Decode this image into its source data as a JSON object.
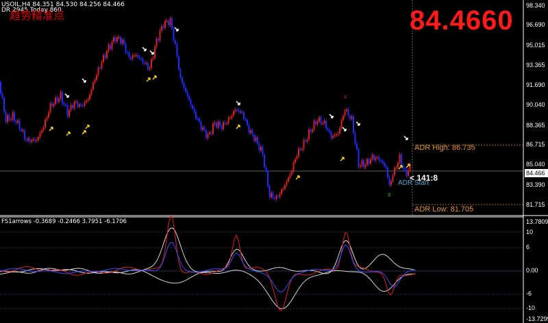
{
  "header": {
    "symbol_line": "USOIL,H4  84.351 84.530 84.256 84.466",
    "adr_line": "DR 2945  Today 860",
    "cn_title": "趋势精准点"
  },
  "overlay": {
    "big_price": "84.4660",
    "adr_high": "ADR High: 86.735",
    "adr_low": "ADR Low: 81.705",
    "ratio": "< 141:8",
    "adr_start": "ADR Start",
    "marker_top": "0",
    "marker_bottom": "0"
  },
  "price_axis": {
    "ticks": [
      "98.340",
      "96.690",
      "95.015",
      "93.365",
      "91.690",
      "90.040",
      "88.365",
      "86.715",
      "85.040",
      "83.390",
      "81.715"
    ],
    "current": "84.466"
  },
  "indicator": {
    "label": "FS1arrows -0.3689 -0.2466 3.7951 -6.1706",
    "ticks": [
      "13.7809",
      "10",
      "6",
      "0.00",
      "-6",
      "-10",
      "-13.7299"
    ]
  },
  "colors": {
    "bull": "#e01e1e",
    "bear": "#1f2bff",
    "adr": "#e8942a",
    "arrow_up": "#ffd21a",
    "arrow_down": "#ffffff",
    "grid": "#4b4b4b"
  }
}
